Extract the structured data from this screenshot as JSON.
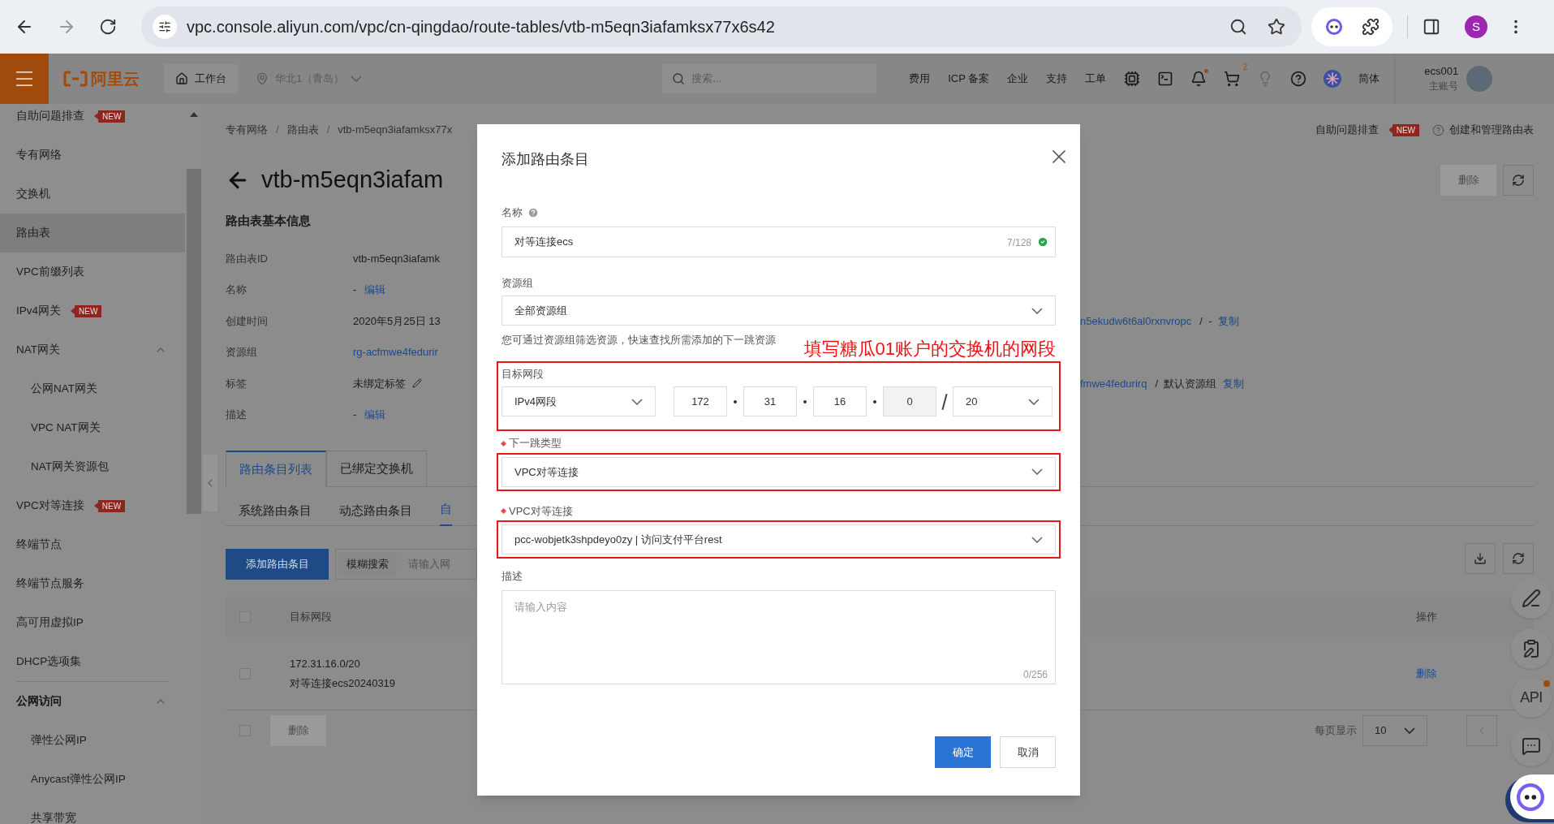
{
  "browser": {
    "url": "vpc.console.aliyun.com/vpc/cn-qingdao/route-tables/vtb-m5eqn3iafamksx77x6s42",
    "profile_initial": "S"
  },
  "topbar": {
    "logo": "阿里云",
    "workbench": "工作台",
    "region": "华北1（青岛）",
    "search_placeholder": "搜索...",
    "menu": [
      "费用",
      "ICP 备案",
      "企业",
      "支持",
      "工单"
    ],
    "cart_count": "2",
    "bell_dot": true,
    "language": "简体",
    "account": "ecs001",
    "account_type": "主账号"
  },
  "sidebar": {
    "items": [
      {
        "label": "自助问题排查",
        "badge": "NEW",
        "selected": false
      },
      {
        "label": "专有网络",
        "selected": false
      },
      {
        "label": "交换机",
        "selected": false
      },
      {
        "label": "路由表",
        "selected": true
      },
      {
        "label": "VPC前缀列表",
        "selected": false
      },
      {
        "label": "IPv4网关",
        "badge": "NEW",
        "selected": false
      },
      {
        "label": "NAT网关",
        "selected": false,
        "expanded": true,
        "children": [
          {
            "label": "公网NAT网关",
            "selected": false
          },
          {
            "label": "VPC NAT网关",
            "selected": false
          },
          {
            "label": "NAT网关资源包",
            "selected": false
          }
        ]
      },
      {
        "label": "VPC对等连接",
        "badge": "NEW",
        "selected": false
      },
      {
        "label": "终端节点",
        "selected": false
      },
      {
        "label": "终端节点服务",
        "selected": false
      },
      {
        "label": "高可用虚拟IP",
        "selected": false
      },
      {
        "label": "DHCP选项集",
        "selected": false
      },
      {
        "label": "公网访问",
        "kind": "section",
        "selected": false,
        "expanded": true,
        "children": [
          {
            "label": "弹性公网IP",
            "selected": false
          },
          {
            "label": "Anycast弹性公网IP",
            "selected": false
          },
          {
            "label": "共享带宽",
            "selected": false
          }
        ]
      }
    ]
  },
  "page": {
    "breadcrumb": [
      {
        "label": "专有网络"
      },
      {
        "separator": "/",
        "label": "路由表"
      },
      {
        "separator": "/",
        "label": "vtb-m5eqn3iafamksx77x"
      }
    ],
    "title": "vtb-m5eqn3iafam",
    "help_links": [
      {
        "label": "自助问题排查",
        "badge": "NEW"
      },
      {
        "label": "创建和管理路由表"
      }
    ],
    "delete_button": {
      "label": "删除",
      "disabled": true
    },
    "section_title": "路由表基本信息",
    "info": [
      {
        "label": "路由表ID",
        "value": "vtb-m5eqn3iafamk"
      },
      {
        "label": "名称",
        "value": "-",
        "action": "编辑"
      },
      {
        "label": "创建时间",
        "value": "2020年5月25日 13",
        "right": {
          "link": "n5ekudw6t6al0rxnvropc",
          "text": "/  -",
          "action": "复制"
        }
      },
      {
        "label": "资源组",
        "value": "rg-acfmwe4fedurir",
        "kind": "link"
      },
      {
        "label": "标签",
        "value": "未绑定标签",
        "kind": "editable",
        "right": {
          "link": "fmwe4fedurirq",
          "text": "/  默认资源组",
          "action": "复制"
        }
      },
      {
        "label": "描述",
        "value": "-",
        "action": "编辑"
      }
    ],
    "tabs": [
      {
        "label": "路由条目列表",
        "selected": true
      },
      {
        "label": "已绑定交换机",
        "selected": false
      }
    ],
    "subtabs": [
      {
        "label": "系统路由条目",
        "selected": false
      },
      {
        "label": "动态路由条目",
        "selected": false
      },
      {
        "label": "自",
        "selected": true
      }
    ],
    "toolbar": {
      "add_button": "添加路由条目",
      "search_mode": "模糊搜索",
      "search_placeholder": "请输入网"
    },
    "table": {
      "header_checked": false,
      "footer_checked": false,
      "columns": [
        "目标网段"
      ],
      "right_columns": [
        "操作"
      ],
      "rows": [
        {
          "checked": false,
          "lines": [
            "172.31.16.0/20",
            "对等连接ecs20240319"
          ],
          "action": "删除"
        }
      ],
      "footer_button": {
        "label": "删除",
        "disabled": true
      }
    },
    "pagination": {
      "label": "每页显示",
      "page_size": "10"
    },
    "floating_tools": [
      {
        "kind": "edit"
      },
      {
        "kind": "feedback"
      },
      {
        "kind": "api",
        "label": "API",
        "dot": true
      },
      {
        "kind": "chat"
      }
    ]
  },
  "modal": {
    "title": "添加路由条目",
    "fields": [
      {
        "kind": "text",
        "label": "名称",
        "help": true,
        "value": "对等连接ecs",
        "counter": "7/128",
        "valid": true
      },
      {
        "kind": "select",
        "label": "资源组",
        "value": "全部资源组",
        "hint": "您可通过资源组筛选资源，快速查找所需添加的下一跳资源"
      },
      {
        "kind": "cidr",
        "label": "目标网段",
        "highlighted": true,
        "type": "IPv4网段",
        "octets": [
          {
            "value": "172",
            "disabled": false
          },
          {
            "value": "31",
            "disabled": false
          },
          {
            "value": "16",
            "disabled": false
          },
          {
            "value": "0",
            "disabled": true
          }
        ],
        "mask": "20"
      },
      {
        "kind": "select",
        "label": "下一跳类型",
        "required": true,
        "highlighted": true,
        "value": "VPC对等连接"
      },
      {
        "kind": "select",
        "label": "VPC对等连接",
        "required": true,
        "highlighted": true,
        "value": "pcc-wobjetk3shpdeyo0zy | 访问支付平台rest"
      },
      {
        "kind": "textarea",
        "label": "描述",
        "placeholder": "请输入内容",
        "counter": "0/256"
      }
    ],
    "annotation": "填写糖瓜01账户的交换机的网段",
    "buttons": [
      {
        "label": "确定",
        "kind": "primary"
      },
      {
        "label": "取消",
        "kind": "default"
      }
    ]
  }
}
